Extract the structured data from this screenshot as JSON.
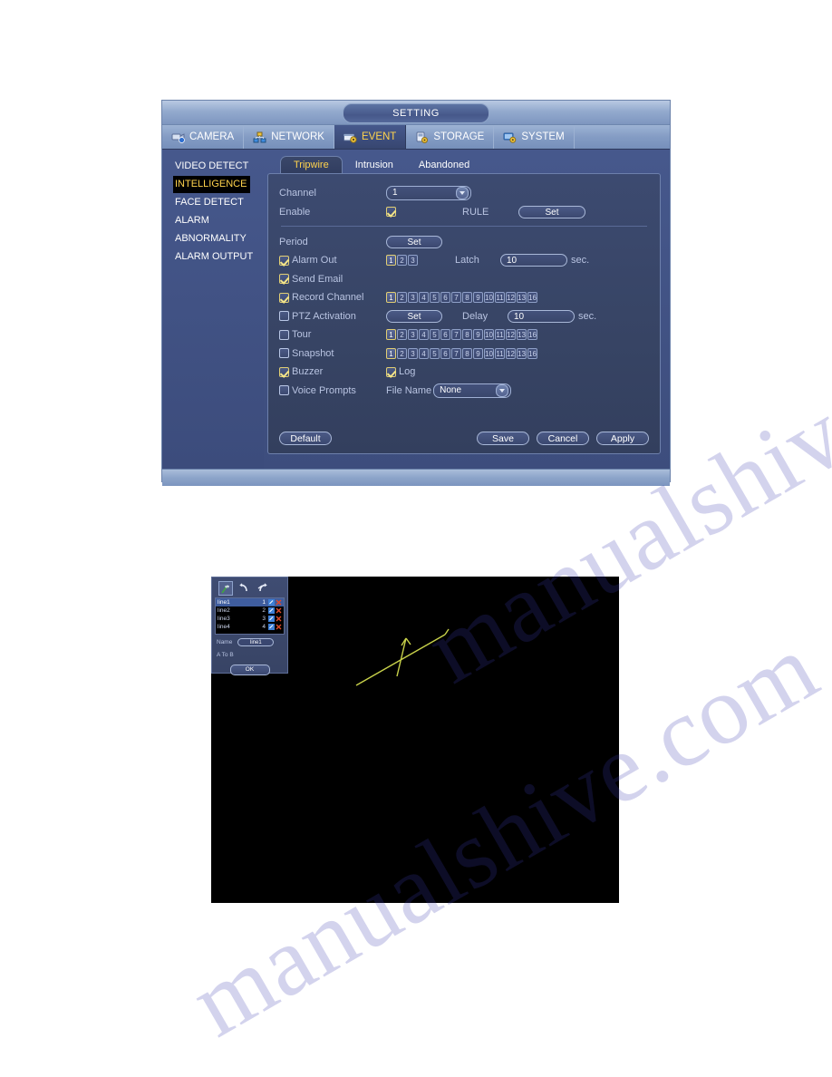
{
  "window": {
    "title": "SETTING"
  },
  "topnav": [
    {
      "label": "CAMERA",
      "icon": "camera-icon",
      "active": false
    },
    {
      "label": "NETWORK",
      "icon": "network-icon",
      "active": false
    },
    {
      "label": "EVENT",
      "icon": "event-icon",
      "active": true
    },
    {
      "label": "STORAGE",
      "icon": "storage-icon",
      "active": false
    },
    {
      "label": "SYSTEM",
      "icon": "system-icon",
      "active": false
    }
  ],
  "sidebar": {
    "items": [
      {
        "label": "VIDEO DETECT",
        "selected": false
      },
      {
        "label": "INTELLIGENCE",
        "selected": true
      },
      {
        "label": "FACE DETECT",
        "selected": false
      },
      {
        "label": "ALARM",
        "selected": false
      },
      {
        "label": "ABNORMALITY",
        "selected": false
      },
      {
        "label": "ALARM OUTPUT",
        "selected": false
      }
    ]
  },
  "subtabs": [
    {
      "label": "Tripwire",
      "active": true
    },
    {
      "label": "Intrusion",
      "active": false
    },
    {
      "label": "Abandoned",
      "active": false
    }
  ],
  "form": {
    "channel_label": "Channel",
    "channel_value": "1",
    "enable_label": "Enable",
    "enable_checked": true,
    "rule_label": "RULE",
    "rule_set_label": "Set",
    "period_label": "Period",
    "period_set_label": "Set",
    "alarm_out_label": "Alarm Out",
    "alarm_out_checked": true,
    "alarm_out_channels": [
      "1",
      "2",
      "3"
    ],
    "alarm_out_selected": [
      "1"
    ],
    "latch_label": "Latch",
    "latch_value": "10",
    "latch_unit": "sec.",
    "send_email_label": "Send Email",
    "send_email_checked": true,
    "record_channel_label": "Record Channel",
    "record_channel_checked": true,
    "ptz_activation_label": "PTZ Activation",
    "ptz_activation_checked": false,
    "ptz_set_label": "Set",
    "delay_label": "Delay",
    "delay_value": "10",
    "delay_unit": "sec.",
    "tour_label": "Tour",
    "tour_checked": false,
    "snapshot_label": "Snapshot",
    "snapshot_checked": false,
    "buzzer_label": "Buzzer",
    "buzzer_checked": true,
    "log_label": "Log",
    "log_checked": true,
    "voice_prompts_label": "Voice Prompts",
    "voice_prompts_checked": false,
    "file_name_label": "File Name",
    "file_name_value": "None",
    "channels": [
      "1",
      "2",
      "3",
      "4",
      "5",
      "6",
      "7",
      "8",
      "9",
      "10",
      "11",
      "12",
      "13",
      "16"
    ],
    "channels_selected": [
      "1"
    ]
  },
  "footer": {
    "default_label": "Default",
    "save_label": "Save",
    "cancel_label": "Cancel",
    "apply_label": "Apply"
  },
  "rule_dialog": {
    "tools": [
      {
        "name": "draw-line-icon",
        "selected": true
      },
      {
        "name": "undo-icon",
        "selected": false
      },
      {
        "name": "redo-icon",
        "selected": false
      }
    ],
    "rows": [
      {
        "name": "line1",
        "no": "1",
        "selected": true
      },
      {
        "name": "line2",
        "no": "2",
        "selected": false
      },
      {
        "name": "line3",
        "no": "3",
        "selected": false
      },
      {
        "name": "line4",
        "no": "4",
        "selected": false
      }
    ],
    "name_label": "Name",
    "name_value": "line1",
    "direction_label": "A To B",
    "ok_label": "OK"
  },
  "watermark": {
    "text": "manualshive.com"
  },
  "colors": {
    "accent_yellow": "#ffd34d",
    "panel_bg": "#3a4768",
    "topbar_blue": "#849cc4",
    "selected_black": "#000000",
    "tripwire_line": "#c8d24a"
  }
}
